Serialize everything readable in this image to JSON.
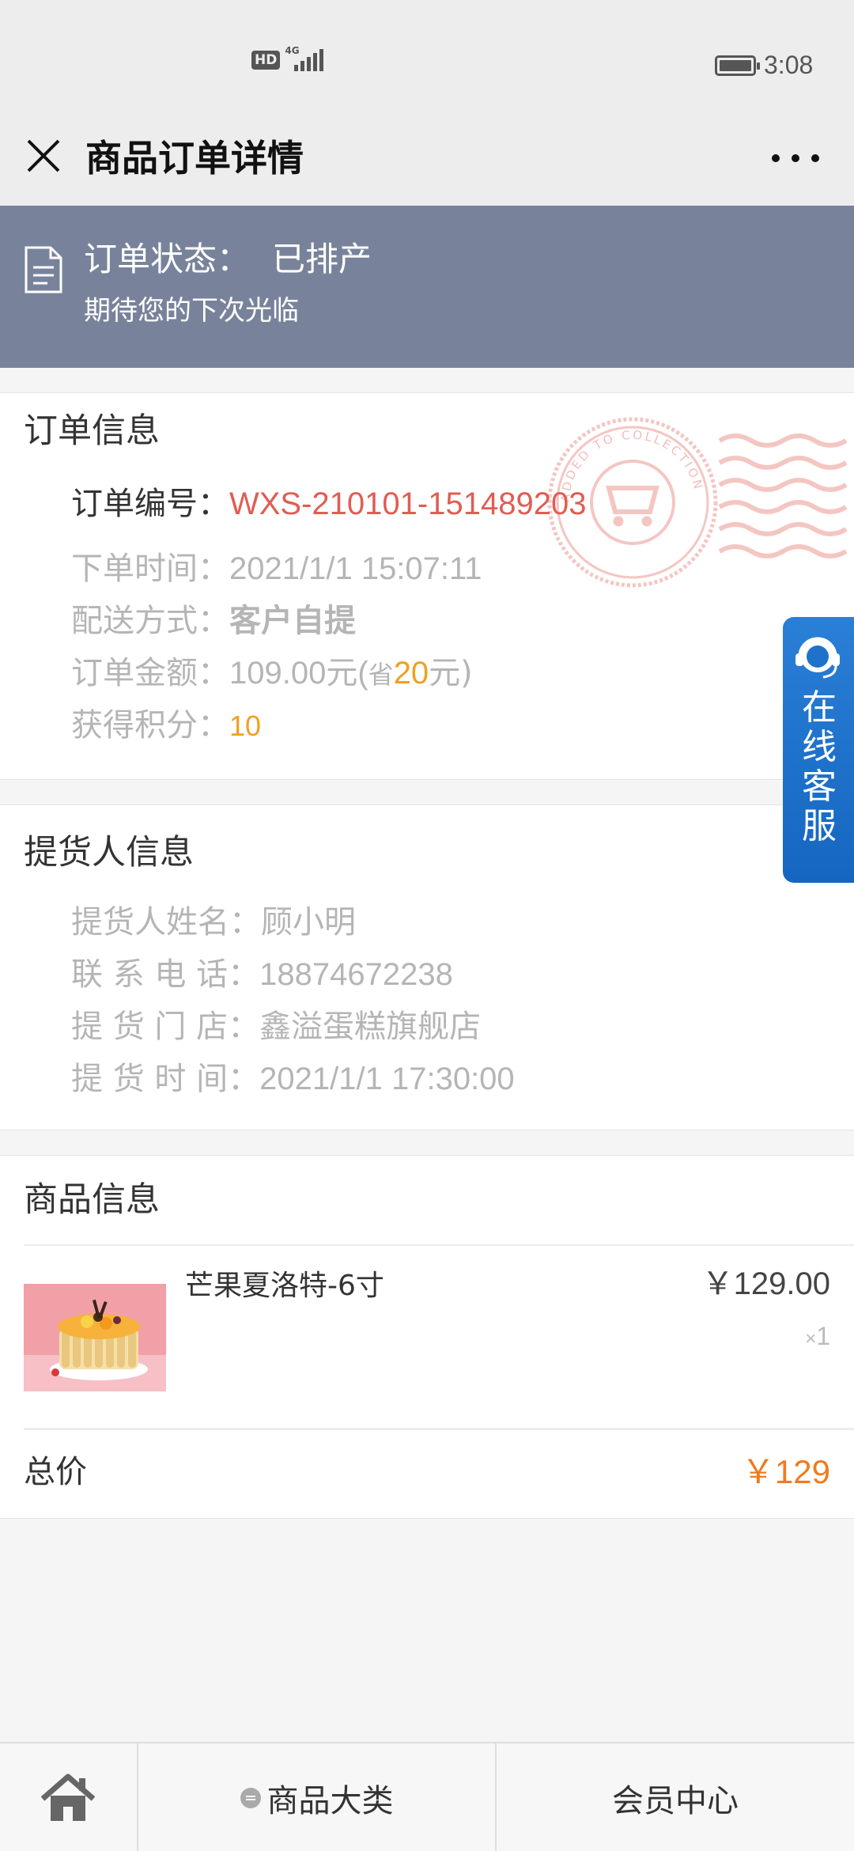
{
  "status_bar": {
    "hd": "HD",
    "network": "4G",
    "time": "3:08"
  },
  "header": {
    "title": "商品订单详情"
  },
  "status_banner": {
    "label": "订单状态：",
    "value": "已排产",
    "subtitle": "期待您的下次光临"
  },
  "order_info": {
    "title": "订单信息",
    "order_no_label": "订单编号：",
    "order_no": "WXS-210101-151489203",
    "time_label": "下单时间：",
    "time": "2021/1/1 15:07:11",
    "delivery_label": "配送方式：",
    "delivery": "客户自提",
    "amount_label": "订单金额：",
    "amount": "109.00元(",
    "save_prefix": "省",
    "save_amount": "20",
    "save_suffix": "元)",
    "points_label": "获得积分：",
    "points": "10",
    "stamp_text": "ADDED TO COLLECTION"
  },
  "pickup_info": {
    "title": "提货人信息",
    "name_label": "提货人姓名：",
    "name": "顾小明",
    "phone_label": "联 系 电 话：",
    "phone": "18874672238",
    "store_label": "提 货 门 店：",
    "store": "鑫溢蛋糕旗舰店",
    "time_label": "提 货 时 间：",
    "time": "2021/1/1 17:30:00"
  },
  "goods_info": {
    "title": "商品信息",
    "items": [
      {
        "name": "芒果夏洛特-6寸",
        "price": "￥129.00",
        "qty_prefix": "×",
        "qty": "1"
      }
    ],
    "total_label": "总价",
    "total": "￥129"
  },
  "customer_service": {
    "chars": [
      "在",
      "线",
      "客",
      "服"
    ]
  },
  "bottom_nav": {
    "category_label": "商品大类",
    "member_label": "会员中心"
  },
  "colors": {
    "banner": "#78839b",
    "order_no": "#e05d53",
    "accent_orange": "#f0a020",
    "total_orange": "#f07b20",
    "service_blue": "#1e72cc"
  },
  "icons": [
    "close-icon",
    "more-icon",
    "document-icon",
    "stamp-icon",
    "headset-icon",
    "home-icon",
    "menu-icon"
  ]
}
